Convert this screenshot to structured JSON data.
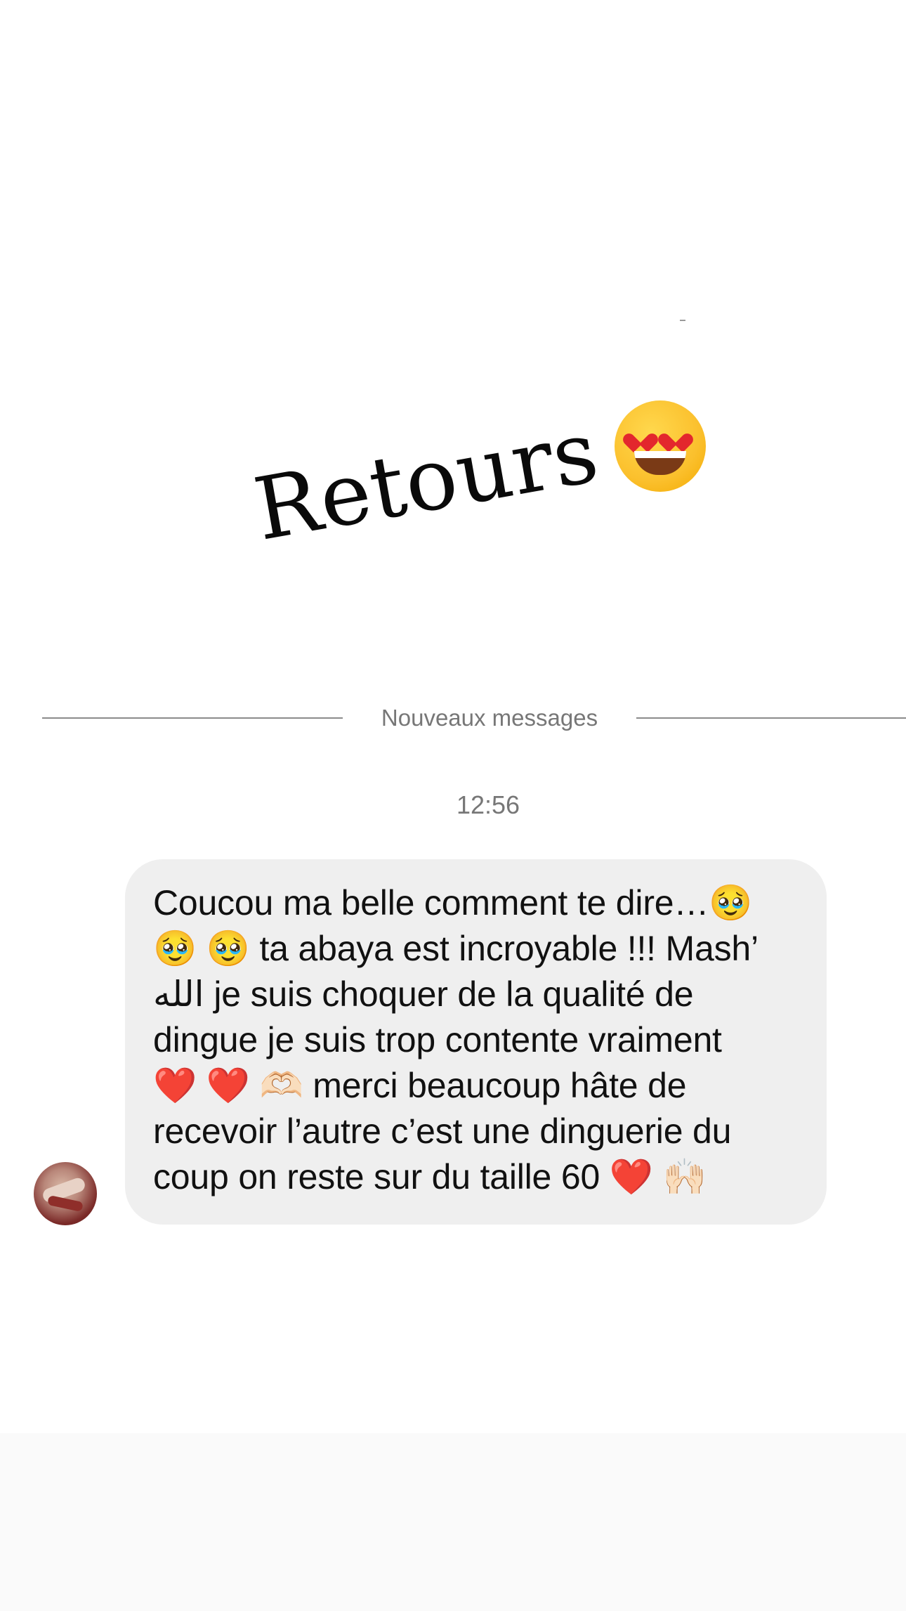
{
  "story": {
    "title": "Retours",
    "title_emoji": "😍",
    "divider_label": "Nouveaux messages",
    "timestamp": "12:56"
  },
  "message": {
    "text": "Coucou ma belle comment te dire…🥹\n🥹 🥹 ta abaya est incroyable !!! Mash’\nالله je suis choquer de la qualité de\ndingue je suis trop contente vraiment\n❤️ ❤️ 🫶🏻 merci beaucoup hâte de\nrecevoir l’autre c’est une dinguerie du\ncoup on reste sur du taille 60 ❤️ 🙌🏻"
  },
  "colors": {
    "bubble_background": "#efefef",
    "divider_text": "#777777",
    "page_background": "#ffffff"
  },
  "icons": {
    "title_emoji": "heart-eyes-emoji",
    "sender_avatar": "avatar"
  }
}
